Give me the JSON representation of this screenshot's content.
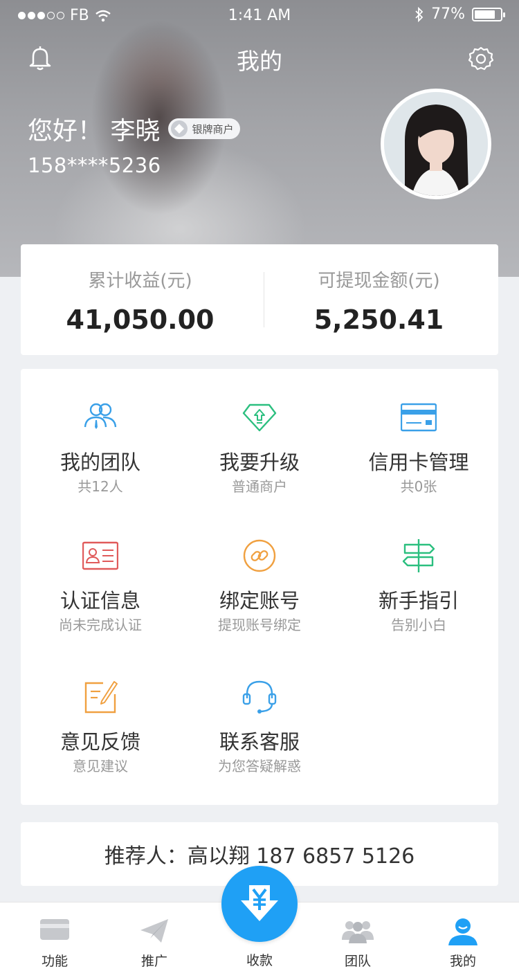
{
  "status_bar": {
    "carrier": "FB",
    "time": "1:41 AM",
    "battery": "77%"
  },
  "header": {
    "title": "我的",
    "greeting": "您好！ 李晓",
    "badge": "银牌商户",
    "phone": "158****5236"
  },
  "stats": {
    "earnings_label": "累计收益(元)",
    "earnings_value": "41,050.00",
    "withdrawable_label": "可提现金额(元)",
    "withdrawable_value": "5,250.41"
  },
  "menu": [
    {
      "title": "我的团队",
      "sub": "共12人",
      "icon": "team-icon",
      "color": "#3aa0e8"
    },
    {
      "title": "我要升级",
      "sub": "普通商户",
      "icon": "upgrade-icon",
      "color": "#2bbf7f"
    },
    {
      "title": "信用卡管理",
      "sub": "共0张",
      "icon": "credit-card-icon",
      "color": "#3aa0e8"
    },
    {
      "title": "认证信息",
      "sub": "尚未完成认证",
      "icon": "id-card-icon",
      "color": "#e05a5a"
    },
    {
      "title": "绑定账号",
      "sub": "提现账号绑定",
      "icon": "link-icon",
      "color": "#f0a040"
    },
    {
      "title": "新手指引",
      "sub": "告别小白",
      "icon": "signpost-icon",
      "color": "#2bbf7f"
    },
    {
      "title": "意见反馈",
      "sub": "意见建议",
      "icon": "feedback-icon",
      "color": "#f0a040"
    },
    {
      "title": "联系客服",
      "sub": "为您答疑解惑",
      "icon": "headset-icon",
      "color": "#3aa0e8"
    }
  ],
  "referrer": "推荐人：高以翔  187 6857 5126",
  "tabs": {
    "functions": "功能",
    "promote": "推广",
    "collect": "收款",
    "team": "团队",
    "mine": "我的"
  },
  "colors": {
    "accent": "#1fa0f5",
    "page_bg": "#eef0f3"
  }
}
